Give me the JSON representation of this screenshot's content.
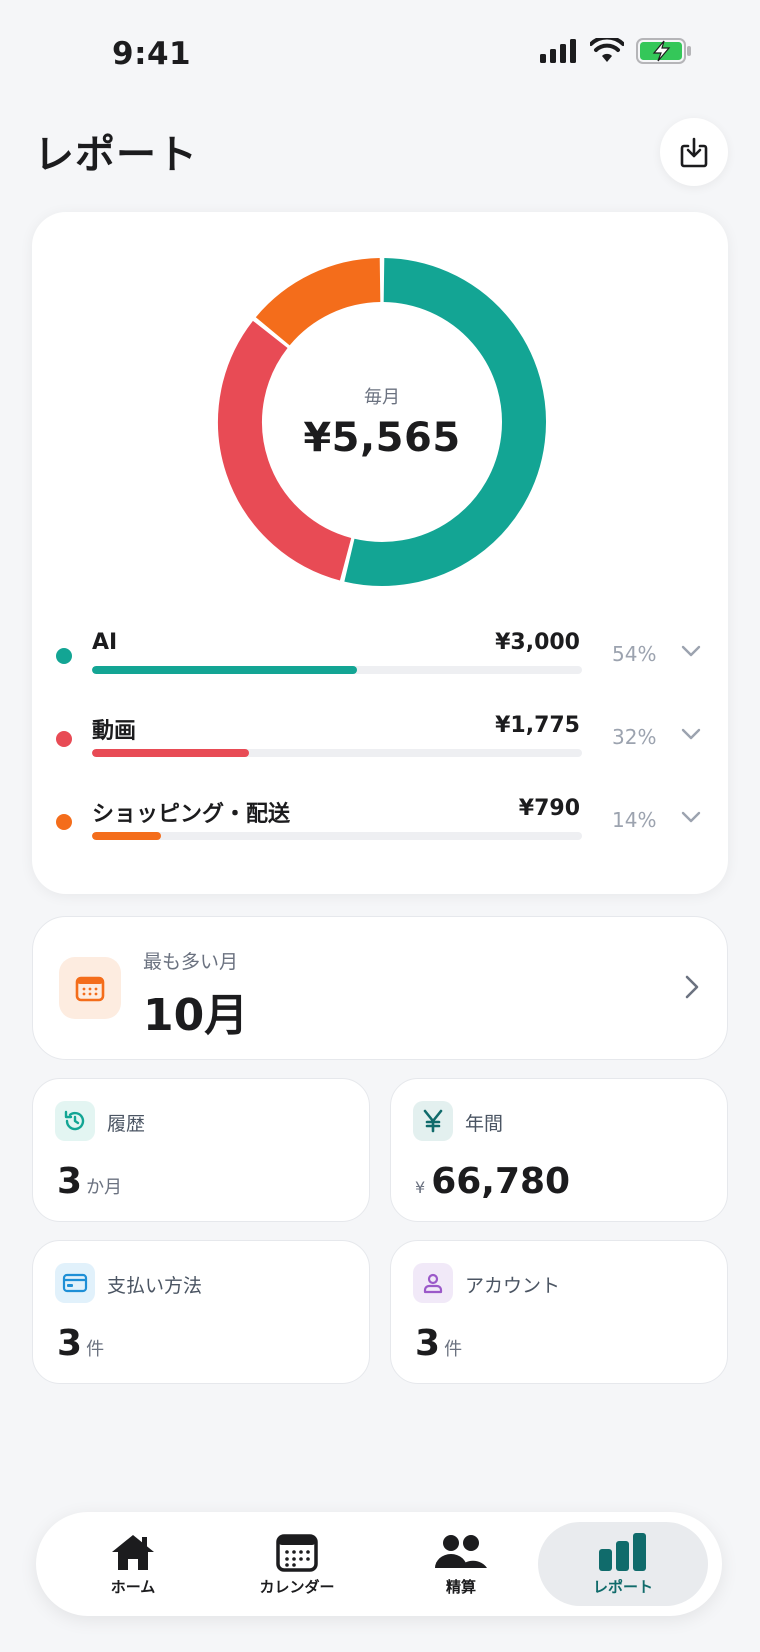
{
  "status_bar": {
    "time": "9:41"
  },
  "header": {
    "title": "レポート"
  },
  "colors": {
    "teal": "#13a594",
    "red": "#e84b55",
    "orange": "#f46d1b",
    "active_tab": "#106b6b"
  },
  "summary": {
    "period_label": "毎月",
    "total": "¥5,565"
  },
  "chart_data": {
    "type": "pie",
    "categories": [
      "AI",
      "動画",
      "ショッピング・配送"
    ],
    "values": [
      3000,
      1775,
      790
    ],
    "percentages": [
      54,
      32,
      14
    ]
  },
  "categories": [
    {
      "name": "AI",
      "amount": "¥3,000",
      "percent": "54%",
      "fraction": 0.54,
      "color": "#13a594"
    },
    {
      "name": "動画",
      "amount": "¥1,775",
      "percent": "32%",
      "fraction": 0.32,
      "color": "#e84b55"
    },
    {
      "name": "ショッピング・配送",
      "amount": "¥790",
      "percent": "14%",
      "fraction": 0.14,
      "color": "#f46d1b"
    }
  ],
  "peak_month": {
    "label": "最も多い月",
    "value": "10月"
  },
  "stats": {
    "history": {
      "label": "履歴",
      "value": "3",
      "unit": "か月"
    },
    "annual": {
      "label": "年間",
      "prefix": "¥",
      "value": "66,780"
    },
    "payment_methods": {
      "label": "支払い方法",
      "value": "3",
      "unit": "件"
    },
    "accounts": {
      "label": "アカウント",
      "value": "3",
      "unit": "件"
    }
  },
  "tabs": [
    {
      "label": "ホーム",
      "icon": "home-icon"
    },
    {
      "label": "カレンダー",
      "icon": "calendar-icon"
    },
    {
      "label": "精算",
      "icon": "people-icon"
    },
    {
      "label": "レポート",
      "icon": "bar-chart-icon",
      "active": true
    }
  ]
}
